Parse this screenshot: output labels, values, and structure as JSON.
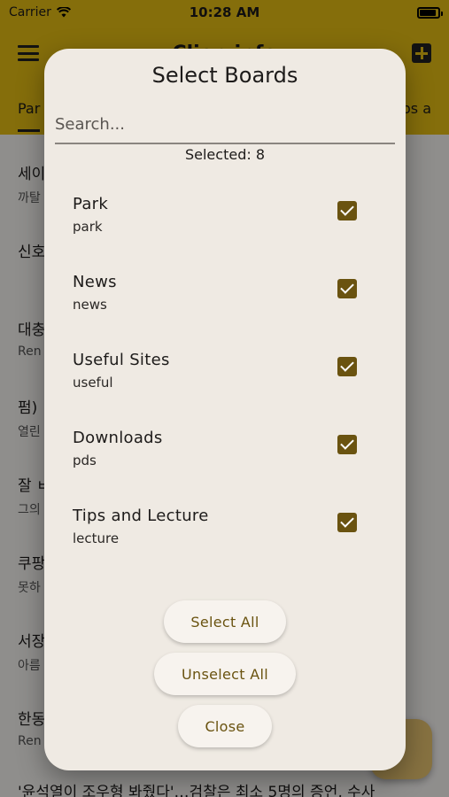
{
  "status_bar": {
    "carrier": "Carrier",
    "time": "10:28 AM"
  },
  "app_bar": {
    "title": "Clien.info"
  },
  "tabs": {
    "left": "Par",
    "right": "Tips a"
  },
  "background_list": [
    {
      "title": "세이",
      "sub": "까탈"
    },
    {
      "title": "신호",
      "sub": ""
    },
    {
      "title": "대충",
      "sub": "Ren"
    },
    {
      "title": "펌)",
      "sub": "열린"
    },
    {
      "title": "잘 ㅂ",
      "sub": "그의"
    },
    {
      "title": "쿠팡",
      "sub": "못하"
    },
    {
      "title": "서장",
      "sub": "아름"
    },
    {
      "title": "한동",
      "sub": "Ren"
    },
    {
      "title": "'윤석열이 조우형 봐줬다'…검찰은 최소 5명의 증언, 수사",
      "sub": ""
    }
  ],
  "dialog": {
    "title": "Select Boards",
    "search_placeholder": "Search...",
    "selected_count": "Selected: 8",
    "boards": [
      {
        "name": "Park",
        "id": "park",
        "checked": true
      },
      {
        "name": "News",
        "id": "news",
        "checked": true
      },
      {
        "name": "Useful Sites",
        "id": "useful",
        "checked": true
      },
      {
        "name": "Downloads",
        "id": "pds",
        "checked": true
      },
      {
        "name": "Tips and Lecture",
        "id": "lecture",
        "checked": true
      }
    ],
    "buttons": {
      "select_all": "Select All",
      "unselect_all": "Unselect All",
      "close": "Close"
    }
  },
  "colors": {
    "accent": "#e6bd14",
    "primary_dark": "#6a5310",
    "dialog_bg": "#efeae3"
  }
}
